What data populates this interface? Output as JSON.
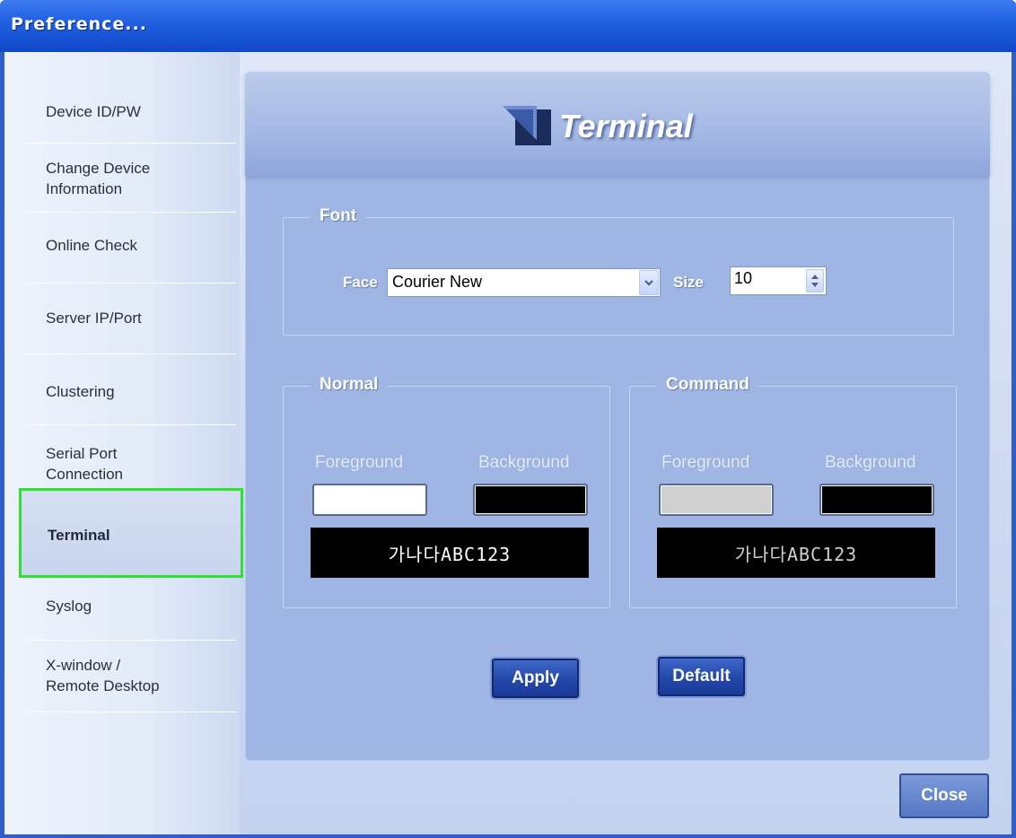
{
  "window": {
    "title": "Preference..."
  },
  "sidebar": {
    "items": [
      {
        "label": "Device ID/PW"
      },
      {
        "label": "Change Device\nInformation"
      },
      {
        "label": "Online Check"
      },
      {
        "label": "Server IP/Port"
      },
      {
        "label": "Clustering"
      },
      {
        "label": "Serial Port\nConnection"
      },
      {
        "label": "Terminal",
        "selected": true
      },
      {
        "label": "Syslog"
      },
      {
        "label": "X-window /\nRemote Desktop"
      }
    ]
  },
  "panel": {
    "heading": "Terminal",
    "font_group": {
      "legend": "Font",
      "face_label": "Face",
      "face_value": "Courier New",
      "size_label": "Size",
      "size_value": "10"
    },
    "normal_group": {
      "legend": "Normal",
      "foreground_label": "Foreground",
      "background_label": "Background",
      "foreground_color": "#ffffff",
      "background_color": "#000000",
      "preview_text": "가나다ABC123"
    },
    "command_group": {
      "legend": "Command",
      "foreground_label": "Foreground",
      "background_label": "Background",
      "foreground_color": "#d0d0d0",
      "background_color": "#000000",
      "preview_text": "가나다ABC123"
    },
    "apply_label": "Apply",
    "default_label": "Default"
  },
  "close_label": "Close",
  "colors": {
    "title_bar": "#1f5fe0",
    "panel_bg": "#9fb5e3",
    "selection_border": "#31e131",
    "button": "#2347a9"
  }
}
